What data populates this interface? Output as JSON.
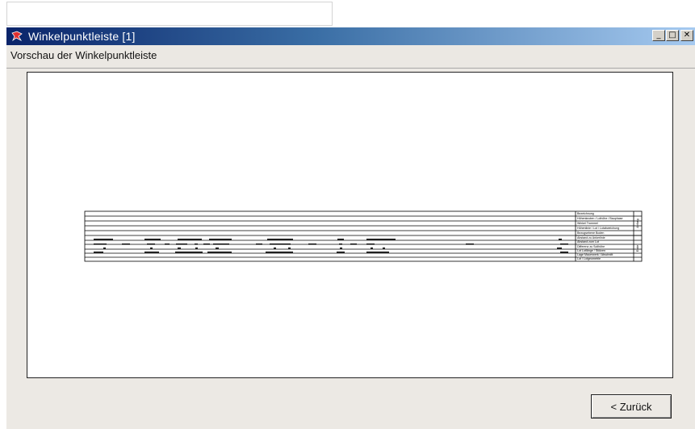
{
  "window": {
    "title": "Winkelpunktleiste [1]",
    "controls": {
      "minimize": "_",
      "maximize": "□",
      "close": "✕"
    }
  },
  "menu": {
    "label": "Vorschau der Winkelpunktleiste"
  },
  "preview": {
    "legend_items": [
      "Bezeichnung",
      "Höhenknoten / Lothöhe / Bauphase",
      "Winkel Trommel",
      "Höhenlinie / Lot / Lotabweichung",
      "Bezugsebene Boden",
      "Abstand zu Ankerlinie",
      "Abstand zum Lot",
      "Differenz zu Sollhöhe",
      "Lot Lotlänge / Stützen",
      "Lage Mauerwerk / Abschnitt",
      "Lot / Lotgeometrie"
    ],
    "side_labels": [
      "Anfang",
      "Ende"
    ]
  },
  "buttons": {
    "back": "< Zurück"
  },
  "colors": {
    "titlebar_start": "#0a246a",
    "titlebar_end": "#a6caf0",
    "window_bg": "#ece9e4"
  }
}
